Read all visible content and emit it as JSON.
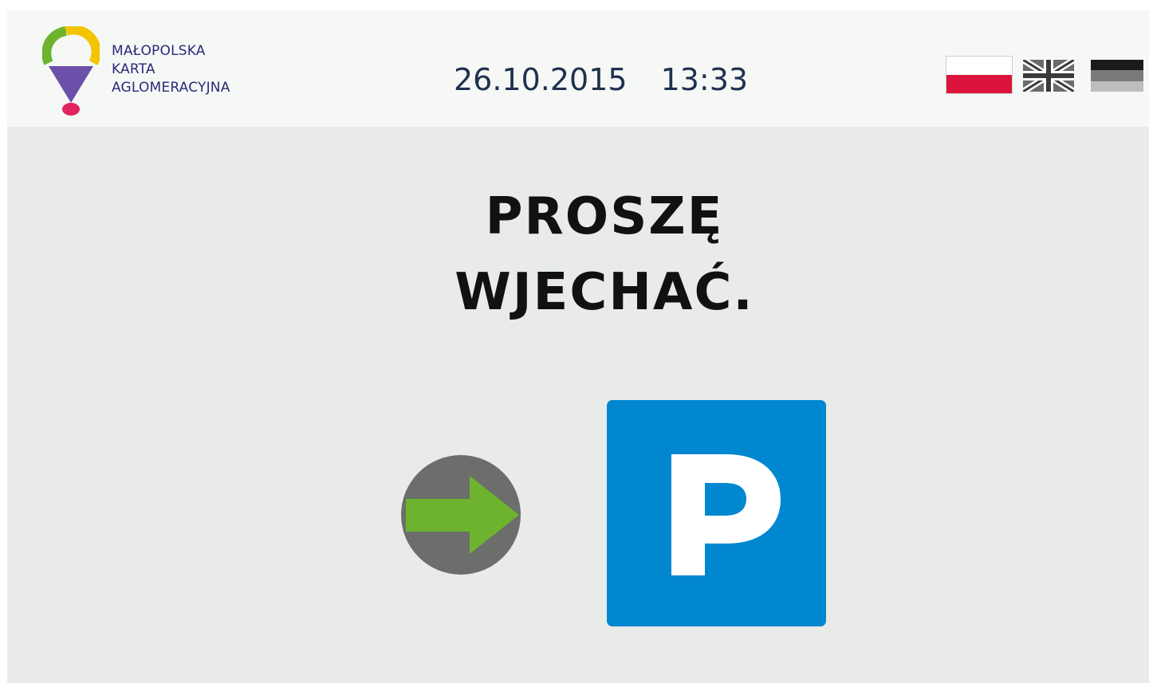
{
  "header": {
    "logo_lines": [
      "MAŁOPOLSKA",
      "KARTA",
      "AGLOMERACYJNA"
    ],
    "date": "26.10.2015",
    "time": "13:33",
    "languages": [
      {
        "code": "pl",
        "icon": "poland-flag-icon"
      },
      {
        "code": "en",
        "icon": "uk-flag-icon"
      },
      {
        "code": "de",
        "icon": "germany-flag-icon"
      }
    ]
  },
  "main": {
    "message_line1": "PROSZĘ",
    "message_line2": "WJECHAĆ.",
    "arrow_icon": "green-arrow-right-icon",
    "parking_icon": "parking-sign-icon",
    "parking_letter": "P"
  },
  "colors": {
    "background": "#e8ebe8",
    "header_background": "#f5f8f5",
    "arrow_green": "#6db32e",
    "arrow_circle": "#6b6e6b",
    "parking_blue": "#0087d0",
    "logo_text": "#2a2a7a",
    "datetime_text": "#1f3050"
  }
}
